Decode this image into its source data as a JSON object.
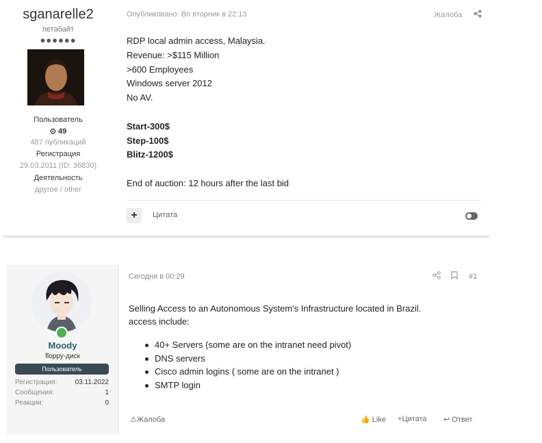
{
  "post1": {
    "author": {
      "username": "sganarelle2",
      "rank": "петабайт",
      "dots": "●●●●●●",
      "role": "Пользователь",
      "reputation": "49",
      "posts": "487 публикаций",
      "registration_label": "Регистрация",
      "registration": "29.03.2011 (ID: 36830)",
      "activity_label": "Деятельность",
      "activity": "другое / other"
    },
    "published": "Опубликовано: Во вторник в 22:13",
    "report_label": "Жалоба",
    "body": {
      "lines": [
        "RDP local admin access, Malaysia.",
        "Revenue: >$115 Million",
        ">600 Employees",
        "Windows server 2012",
        "No AV."
      ],
      "bids": [
        "Start-300$",
        "Step-100$",
        "Blitz-1200$"
      ],
      "end": "End of auction: 12 hours after the last bid"
    },
    "quote_label": "Цитата"
  },
  "post2": {
    "author": {
      "username": "Moody",
      "title": "floppy-диск",
      "badge": "Пользователь",
      "stats": [
        {
          "label": "Регистрация:",
          "value": "03.11.2022"
        },
        {
          "label": "Сообщения:",
          "value": "1"
        },
        {
          "label": "Реакции:",
          "value": "0"
        }
      ]
    },
    "date": "Сегодня в 00:29",
    "post_number": "#1",
    "intro": [
      "Selling Access to an Autonomous System's Infrastructure located in Brazil.",
      "access include:"
    ],
    "items": [
      "40+ Servers (some are on the intranet need pivot)",
      "DNS servers",
      "Cisco admin logins ( some are on the intranet )",
      "SMTP login"
    ],
    "actions": {
      "report": "Жалоба",
      "like": "Like",
      "quote": "Цитата",
      "reply": "Ответ"
    }
  },
  "icons": {
    "share": "share-icon",
    "bookmark": "bookmark-icon",
    "plus": "plus-icon",
    "reputation": "reputation-icon",
    "toggle": "toggle-icon"
  }
}
